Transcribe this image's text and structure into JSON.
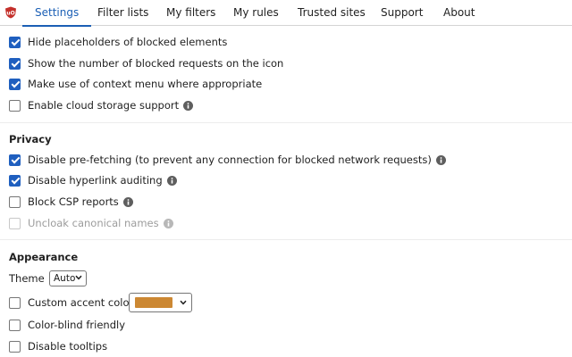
{
  "tabs": [
    {
      "label": "Settings",
      "active": true
    },
    {
      "label": "Filter lists",
      "active": false
    },
    {
      "label": "My filters",
      "active": false
    },
    {
      "label": "My rules",
      "active": false
    },
    {
      "label": "Trusted sites",
      "active": false
    },
    {
      "label": "Support",
      "active": false
    },
    {
      "label": "About",
      "active": false
    }
  ],
  "colors": {
    "accent": "#1b5fb5",
    "checkbox_checked": "#1f5fbf",
    "logo_red": "#c4302b",
    "accent_swatch": "#cc8833"
  },
  "general": [
    {
      "label": "Hide placeholders of blocked elements",
      "checked": true,
      "info": false,
      "disabled": false
    },
    {
      "label": "Show the number of blocked requests on the icon",
      "checked": true,
      "info": false,
      "disabled": false
    },
    {
      "label": "Make use of context menu where appropriate",
      "checked": true,
      "info": false,
      "disabled": false
    },
    {
      "label": "Enable cloud storage support",
      "checked": false,
      "info": true,
      "disabled": false
    }
  ],
  "privacy": {
    "heading": "Privacy",
    "items": [
      {
        "label": "Disable pre-fetching (to prevent any connection for blocked network requests)",
        "checked": true,
        "info": true,
        "disabled": false
      },
      {
        "label": "Disable hyperlink auditing",
        "checked": true,
        "info": true,
        "disabled": false
      },
      {
        "label": "Block CSP reports",
        "checked": false,
        "info": true,
        "disabled": false
      },
      {
        "label": "Uncloak canonical names",
        "checked": false,
        "info": true,
        "disabled": true
      }
    ]
  },
  "appearance": {
    "heading": "Appearance",
    "theme_label": "Theme",
    "theme_value": "Auto",
    "custom_accent": {
      "label": "Custom accent color",
      "checked": false
    },
    "color_blind": {
      "label": "Color-blind friendly",
      "checked": false
    },
    "tooltips": {
      "label": "Disable tooltips",
      "checked": false
    }
  },
  "icons": {
    "logo": "ublock-origin-logo-icon",
    "info": "info-icon",
    "dropdown": "chevron-down-icon"
  }
}
